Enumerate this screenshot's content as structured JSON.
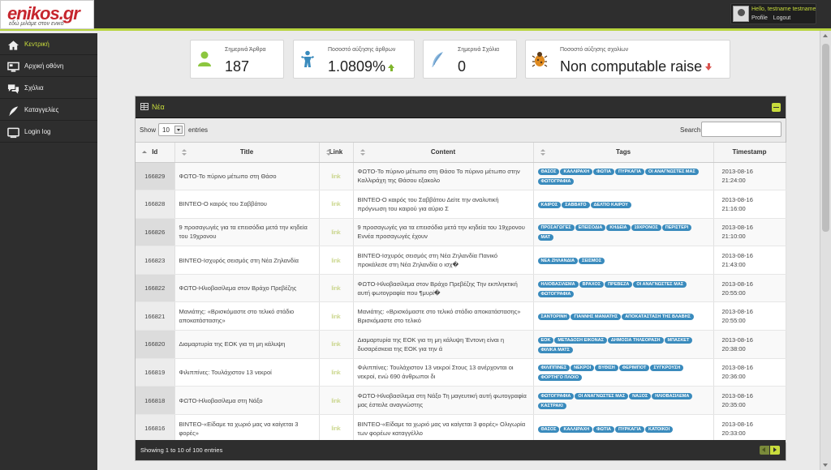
{
  "logo": {
    "text": "enikos.gr",
    "tagline": "εδώ μιλάμε στον ενικό"
  },
  "user": {
    "hello": "Hello, testname testname",
    "profile": "Profile",
    "logout": "Logout"
  },
  "sidebar": {
    "items": [
      {
        "label": "Κεντρική",
        "icon": "home-icon",
        "active": true
      },
      {
        "label": "Αρχική οθόνη",
        "icon": "monitor-icon",
        "active": false
      },
      {
        "label": "Σχόλια",
        "icon": "comments-icon",
        "active": false
      },
      {
        "label": "Καταγγελίες",
        "icon": "feather-icon",
        "active": false
      },
      {
        "label": "Login log",
        "icon": "screen-icon",
        "active": false
      }
    ]
  },
  "stats": [
    {
      "label": "Σημερινά Άρθρα",
      "value": "187",
      "icon": "user-icon"
    },
    {
      "label": "Ποσοστό αύξησης άρθρων",
      "value": "1.0809%",
      "icon": "person-icon",
      "trend": "up"
    },
    {
      "label": "Σημερινά Σχόλια",
      "value": "0",
      "icon": "feather-icon"
    },
    {
      "label": "Ποσοστό αύξησης σχολίων",
      "value": "Non computable raise",
      "icon": "bug-icon",
      "trend": "down"
    }
  ],
  "panel": {
    "title": "Νέα",
    "show_label": "Show",
    "page_size": "10",
    "entries_label": "entries",
    "search_label": "Search:",
    "search_value": "",
    "columns": [
      "Id",
      "Title",
      "Link",
      "Content",
      "Tags",
      "Timestamp"
    ],
    "footer": "Showing 1 to 10 of 100 entries"
  },
  "rows": [
    {
      "id": "166829",
      "title": "ΦΩΤΟ-Το πύρινο μέτωπο στη Θάσο",
      "link": "link",
      "content": "ΦΩΤΟ-Το πύρινο μέτωπο στη Θάσο   Το πύρινο μέτωπο στην Καλλιράχη της Θάσου εξακολο",
      "tags": [
        "ΘΑΣΟΣ",
        "ΚΑΛΛΙΡΑΧΗ",
        "ΦΩΤΙΑ",
        "ΠΥΡΚΑΓΙΑ",
        "ΟΙ ΑΝΑΓΝΩΣΤΕΣ ΜΑΣ",
        "ΦΩΤΟΓΡΑΦΙΑ"
      ],
      "date": "2013-08-16",
      "time": "21:24:00"
    },
    {
      "id": "166828",
      "title": "ΒΙΝΤΕΟ-Ο καιρός του Σαββάτου",
      "link": "link",
      "content": "ΒΙΝΤΕΟ-Ο καιρός του Σαββάτου   Δείτε την αναλυτική πρόγνωση του καιρού για αύριο Σ",
      "tags": [
        "ΚΑΙΡΟΣ",
        "ΣΑΒΒΑΤΟ",
        "ΔΕΛΤΙΟ ΚΑΙΡΟΥ"
      ],
      "date": "2013-08-16",
      "time": "21:16:00"
    },
    {
      "id": "166826",
      "title": "9 προσαγωγές για τα επεισόδια μετά την κηδεία του 19χρονου",
      "link": "link",
      "content": "9 προσαγωγές για τα επεισόδια μετά την κηδεία του 19χρονου   Εννέα προσαγωγές έχουν",
      "tags": [
        "ΠΡΟΣΑΓΩΓΕΣ",
        "ΕΠΕΙΣΟΔΙΑ",
        "ΚΗΔΕΙΑ",
        "19ΧΡΟΝΟΣ",
        "ΠΕΡΙΣΤΕΡΙ",
        "ΜΑΤ"
      ],
      "date": "2013-08-16",
      "time": "21:10:00"
    },
    {
      "id": "166823",
      "title": "ΒΙΝΤΕΟ-Ισχυρός σεισμός στη Νέα Ζηλανδία",
      "link": "link",
      "content": "ΒΙΝΤΕΟ-Ισχυρός σεισμός στη Νέα Ζηλανδία   Πανικό προκάλεσε στη Νέα Ζηλανδία ο ισχ�",
      "tags": [
        "ΝΕΑ ΖΗΛΑΝΔΙΑ",
        "ΣΕΙΣΜΟΣ"
      ],
      "date": "2013-08-16",
      "time": "21:43:00"
    },
    {
      "id": "166822",
      "title": "ΦΩΤΟ-Ηλιοβασίλεμα στον Βράχο Πρεβέζης",
      "link": "link",
      "content": "ΦΩΤΟ-Ηλιοβασίλεμα στον Βράχο Πρεβέζης   Την εκπληκτική αυτή φωτογραφία που ¶μυρί�",
      "tags": [
        "ΗΛΙΟΒΑΣΙΛΕΜΑ",
        "ΒΡΑΧΟΣ",
        "ΠΡΕΒΕΖΑ",
        "ΟΙ ΑΝΑΓΝΩΣΤΕΣ ΜΑΣ",
        "ΦΩΤΟΓΡΑΦΙΑ"
      ],
      "date": "2013-08-16",
      "time": "20:55:00"
    },
    {
      "id": "166821",
      "title": "Μανιάτης: «Βρισκόμαστε στο τελικό στάδιο αποκατάστασης»",
      "link": "link",
      "content": "Μανιάτης: «Βρισκόμαστε στο τελικό στάδιο αποκατάστασης»   Βρισκόμαστε στο τελικό",
      "tags": [
        "ΣΑΝΤΟΡΙΝΗ",
        "ΓΙΑΝΝΗΣ ΜΑΝΙΑΤΗΣ",
        "ΑΠΟΚΑΤΑΣΤΑΣΗ ΤΗΣ ΒΛΑΒΗΣ"
      ],
      "date": "2013-08-16",
      "time": "20:55:00"
    },
    {
      "id": "166820",
      "title": "Διαμαρτυρία της ΕΟΚ για τη μη κάλυψη",
      "link": "link",
      "content": "Διαμαρτυρία της ΕΟΚ για τη μη κάλυψη   Έντονη είναι η δυσαρέσκεια της ΕΟΚ για την ά",
      "tags": [
        "ΕΟΚ",
        "ΜΕΤΑΔΟΣΗ ΕΙΚΟΝΑΣ",
        "ΔΗΜΟΣΙΑ ΤΗΛΕΟΡΑΣΗ",
        "ΜΠΑΣΚΕΤ",
        "ΦΙΛΙΚΑ ΜΑΤΣ"
      ],
      "date": "2013-08-16",
      "time": "20:38:00"
    },
    {
      "id": "166819",
      "title": "Φιλιππίνες: Τουλάχιστον 13 νεκροί",
      "link": "link",
      "content": "Φιλιππίνες: Τουλάχιστον 13 νεκροί   Στους 13 ανέρχονται οι νεκροί, ενώ 690 άνθρωποι δι",
      "tags": [
        "ΦΙΛΙΠΠΙΝΕΣ",
        "ΝΕΚΡΟΙ",
        "ΒΥΘΙΣΗ",
        "ΦΕΡΙΜΠΟΤ",
        "ΣΥΓΚΡΟΥΣΗ",
        "ΦΟΡΤΗΓΟ ΠΛΟΙΟ"
      ],
      "date": "2013-08-16",
      "time": "20:36:00"
    },
    {
      "id": "166818",
      "title": "ΦΩΤΟ-Ηλιοβασίλεμα στη Νάξο",
      "link": "link",
      "content": "ΦΩΤΟ-Ηλιοβασίλεμα στη Νάξο   Τη μαγευτική αυτή φωτογραφία μας έστειλε αναγνώστης",
      "tags": [
        "ΦΩΤΟΓΡΑΦΙΑ",
        "ΟΙ ΑΝΑΓΝΩΣΤΕΣ ΜΑΣ",
        "ΝΑΞΟΣ",
        "ΗΛΙΟΒΑΣΙΛΕΜΑ",
        "ΚΑΣΤΡΑΚΙ"
      ],
      "date": "2013-08-16",
      "time": "20:35:00"
    },
    {
      "id": "166816",
      "title": "ΒΙΝΤΕΟ-«Είδαμε τα χωριό μας να καίγεται 3 φορές»",
      "link": "link",
      "content": "ΒΙΝΤΕΟ-«Είδαμε τα χωριό μας να καίγεται 3 φορές»   Ολιγωρία των φορέων καταγγέλλο",
      "tags": [
        "ΘΑΣΟΣ",
        "ΚΑΛΛΙΡΑΧΗ",
        "ΦΩΤΙΑ",
        "ΠΥΡΚΑΓΙΑ",
        "ΚΑΤΟΙΚΟΙ"
      ],
      "date": "2013-08-16",
      "time": "20:33:00"
    }
  ],
  "colors": {
    "accent": "#c8dc3c",
    "dark": "#2e2e2e",
    "tag": "#3a8bbd",
    "link": "#b8c864",
    "up": "#7fb52b",
    "down": "#d9534f"
  }
}
